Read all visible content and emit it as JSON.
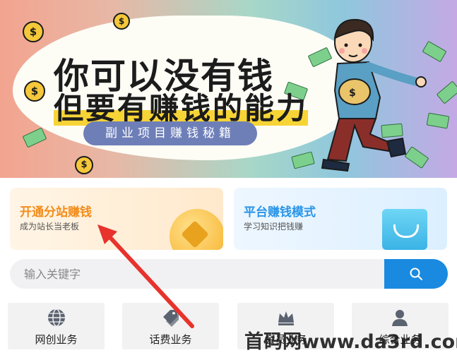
{
  "banner": {
    "title_line1": "你可以没有钱",
    "title_line2": "但要有赚钱的能力",
    "pill_label": "副业项目赚钱秘籍",
    "coin_glyph": "$"
  },
  "cards": {
    "left": {
      "title": "开通分站赚钱",
      "subtitle": "成为站长当老板",
      "accent": "#f28c1a"
    },
    "right": {
      "title": "平台赚钱模式",
      "subtitle": "学习知识把钱赚",
      "accent": "#2a95e8"
    }
  },
  "search": {
    "placeholder": "输入关键字",
    "value": "",
    "button_icon": "search-icon",
    "button_color": "#1a8ae0"
  },
  "nav": {
    "items": [
      {
        "label": "网创业务",
        "icon": "globe-icon"
      },
      {
        "label": "话费业务",
        "icon": "tags-icon"
      },
      {
        "label": "会员业务",
        "icon": "crown-icon"
      },
      {
        "label": "综合业务",
        "icon": "user-icon"
      }
    ]
  },
  "watermark": {
    "text": "首码网www.da3rd.com"
  },
  "annotation": {
    "arrow_color": "#e8322c"
  }
}
